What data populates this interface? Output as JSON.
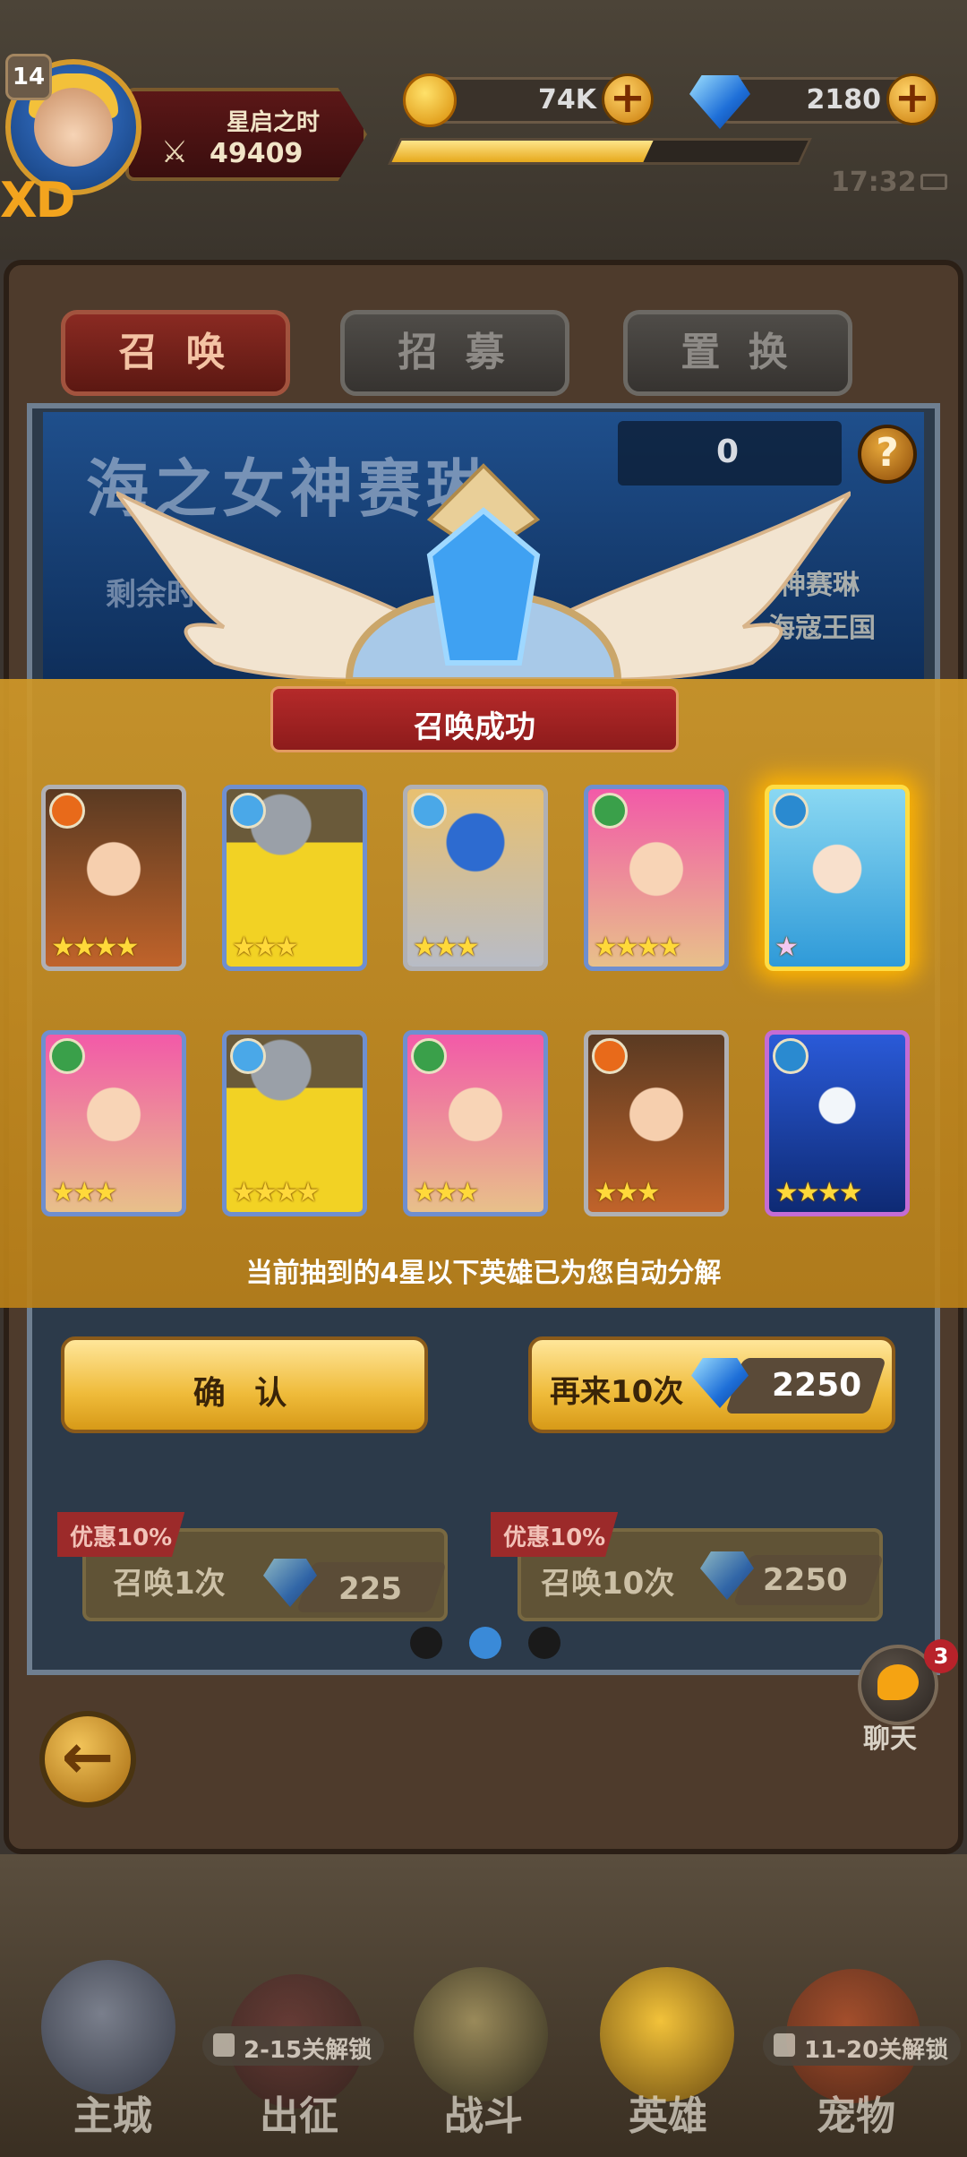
{
  "header": {
    "level": "14",
    "player_name": "星启之时",
    "power": "49409",
    "coins": "74K",
    "gems": "2180",
    "exp_progress": 0.62,
    "clock": "17:32",
    "corner_text": "XD"
  },
  "tabs": [
    {
      "label": "召 唤",
      "active": true
    },
    {
      "label": "招 募",
      "active": false
    },
    {
      "label": "置 换",
      "active": false
    }
  ],
  "banner": {
    "title": "海之女神赛琳",
    "left_text": "剩余时",
    "right_text_1": "神赛琳",
    "right_text_2": "海寇王国",
    "shard_count": "0",
    "help_label": "?"
  },
  "result": {
    "title": "召唤成功",
    "notice": "当前抽到的4星以下英雄已为您自动分解",
    "heroes": [
      {
        "name": "pilot-girl",
        "element": "fire",
        "stars": 4,
        "highlight": false
      },
      {
        "name": "viking-blob",
        "element": "ice",
        "stars": 3,
        "highlight": false
      },
      {
        "name": "armored-knight",
        "element": "ice",
        "stars": 3,
        "highlight": false
      },
      {
        "name": "pink-hair-girl",
        "element": "nature",
        "stars": 4,
        "highlight": false
      },
      {
        "name": "sea-goddess",
        "element": "water",
        "stars": 1,
        "highlight": true
      },
      {
        "name": "pink-hair-girl",
        "element": "nature",
        "stars": 3,
        "highlight": false
      },
      {
        "name": "viking-blob",
        "element": "ice",
        "stars": 4,
        "highlight": false
      },
      {
        "name": "pink-hair-girl",
        "element": "nature",
        "stars": 3,
        "highlight": false
      },
      {
        "name": "pilot-girl",
        "element": "fire",
        "stars": 3,
        "highlight": false
      },
      {
        "name": "shark-warrior",
        "element": "water",
        "stars": 4,
        "highlight": false
      }
    ]
  },
  "buttons": {
    "confirm": "确 认",
    "again": "再来10次",
    "again_price": "2250"
  },
  "summon_options": [
    {
      "discount": "优惠10%",
      "label": "召唤1次",
      "price": "225"
    },
    {
      "discount": "优惠10%",
      "label": "召唤10次",
      "price": "2250"
    }
  ],
  "chat": {
    "label": "聊天",
    "badge": "3"
  },
  "bottom_nav": [
    {
      "label": "主城",
      "lock": ""
    },
    {
      "label": "出征",
      "lock": "2-15关解锁"
    },
    {
      "label": "战斗",
      "lock": ""
    },
    {
      "label": "英雄",
      "lock": ""
    },
    {
      "label": "宠物",
      "lock": "11-20关解锁"
    }
  ],
  "colors": {
    "accent_gold": "#efbb3a",
    "title_red": "#b52a2a",
    "gem_blue": "#1e6fd8"
  }
}
